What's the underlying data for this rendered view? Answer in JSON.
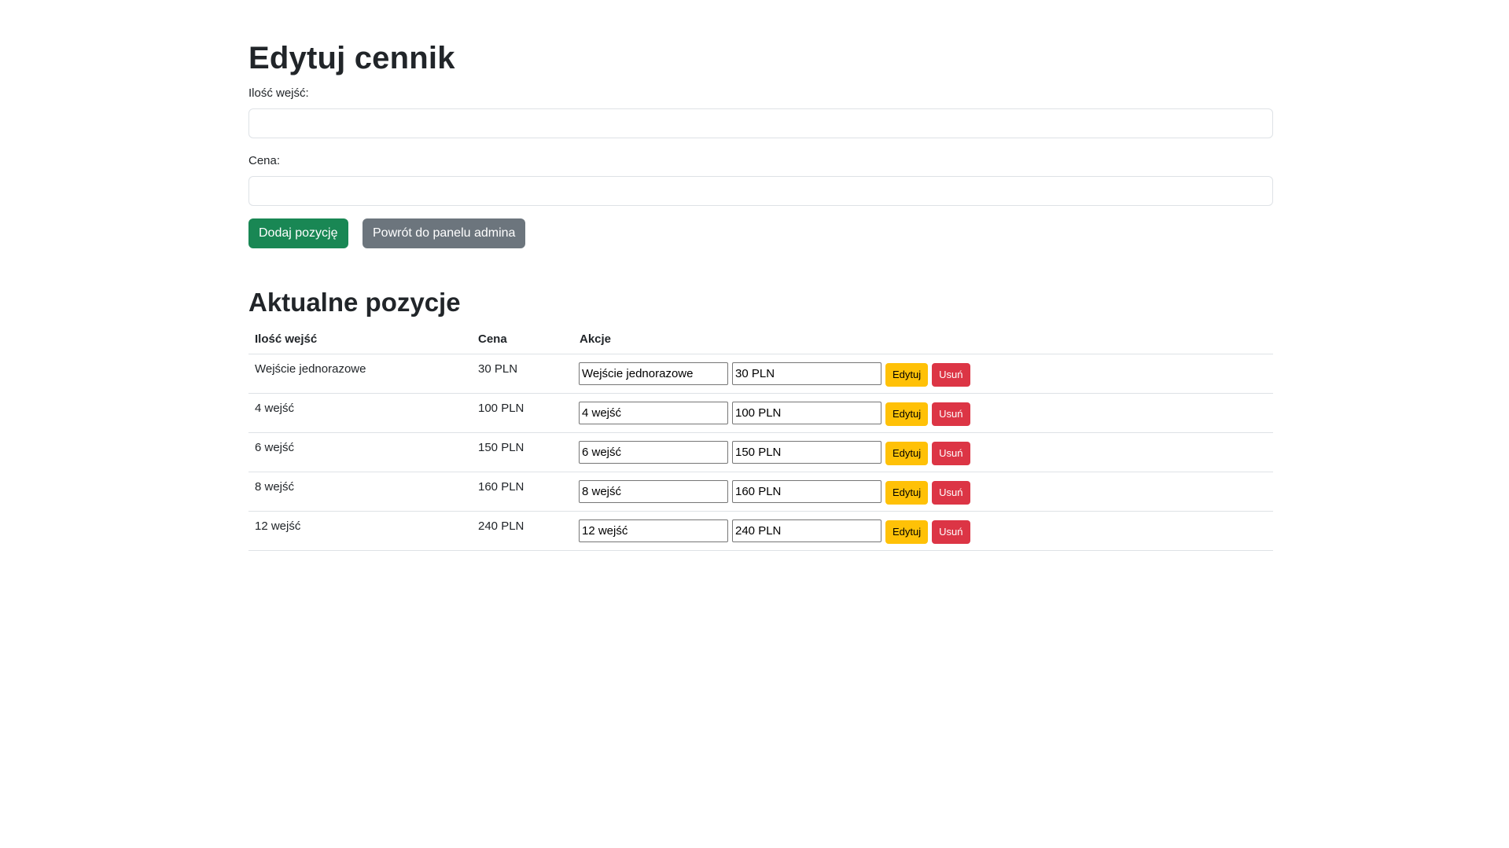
{
  "page": {
    "title": "Edytuj cennik"
  },
  "form": {
    "entries_label": "Ilość wejść:",
    "entries_value": "",
    "price_label": "Cena:",
    "price_value": "",
    "add_button": "Dodaj pozycję",
    "back_button": "Powrót do panelu admina"
  },
  "current": {
    "title": "Aktualne pozycje",
    "headers": [
      "Ilość wejść",
      "Cena",
      "Akcje"
    ],
    "rows": [
      {
        "name": "Wejście jednorazowe",
        "price": "30 PLN"
      },
      {
        "name": "4 wejść",
        "price": "100 PLN"
      },
      {
        "name": "6 wejść",
        "price": "150 PLN"
      },
      {
        "name": "8 wejść",
        "price": "160 PLN"
      },
      {
        "name": "12 wejść",
        "price": "240 PLN"
      }
    ],
    "edit_label": "Edytuj",
    "delete_label": "Usuń"
  },
  "colors": {
    "success": "#198754",
    "secondary": "#6c757d",
    "warning": "#ffc107",
    "danger": "#dc3545"
  }
}
